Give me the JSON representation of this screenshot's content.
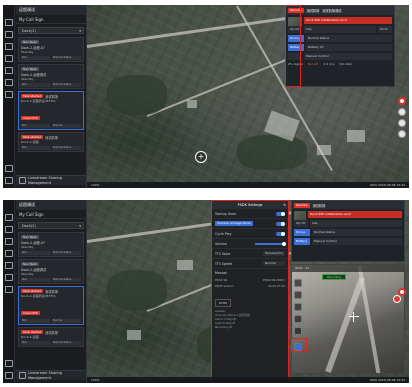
{
  "screens": [
    {
      "sidebar": {
        "header": "远程调试",
        "title": "My Call Sign",
        "selector": "Dock(2)",
        "cards": [
          {
            "pill": "Nav Nest",
            "pill_color": "grey",
            "name": "Dock-2-远程-07",
            "row": "Standby",
            "sub": [
              "N/A",
              "Normal status"
            ]
          },
          {
            "pill": "Nav Nest",
            "pill_color": "grey",
            "name": "Dock-2-远程调试",
            "row": "Standby",
            "sub": [
              "N/A",
              "Normal status"
            ]
          },
          {
            "pill": "Task started",
            "pill_color": "red",
            "name": "测试机场",
            "row": "Dock-2-远程调试(M3TD)",
            "alert": "Check RTK",
            "sub": [
              "N/A",
              "Normal"
            ]
          },
          {
            "pill": "Task started",
            "pill_color": "red",
            "name": "测试机场",
            "row": "Dock-2-远程",
            "sub": [
              "N/A",
              "Normal status"
            ]
          }
        ],
        "uplink": "Livestream Sharing Management"
      },
      "device_panel": {
        "header_tag": "Remote",
        "title": "测试机场",
        "title2": "测试机场调试",
        "alert": "Dock RTK initialization error",
        "rows": [
          [
            "Op Ctl",
            "Idle",
            "Dock"
          ],
          [
            "Drone",
            "Normal status",
            ""
          ],
          [
            "Battery",
            "Battery 97",
            ""
          ],
          [
            "",
            "Manual Control",
            ""
          ]
        ],
        "stats": [
          "0% Signal",
          "N/A Alt",
          "2.9 m/s",
          "N/A Dist"
        ]
      },
      "status": {
        "left": "100%",
        "right": "WGS 2025-08-08 15:44"
      }
    },
    {
      "sidebar": {
        "header": "远程调试",
        "title": "My Call Sign",
        "selector": "Dock(2)",
        "cards": [
          {
            "pill": "Nav Nest",
            "pill_color": "grey",
            "name": "Dock-2-远程-07",
            "row": "Standby",
            "sub": [
              "N/A",
              "Normal status"
            ]
          },
          {
            "pill": "Nav Nest",
            "pill_color": "grey",
            "name": "Dock-2-远程调试",
            "row": "Standby",
            "sub": [
              "N/A",
              "Normal status"
            ]
          },
          {
            "pill": "Task started",
            "pill_color": "red",
            "name": "测试机场",
            "row": "Dock-2-远程调试(M3TD)",
            "alert": "Check RTK",
            "sub": [
              "N/A",
              "Normal"
            ]
          },
          {
            "pill": "Task started",
            "pill_color": "red",
            "name": "测试机场",
            "row": "Dock-2-远程",
            "sub": [
              "N/A",
              "Normal status"
            ]
          }
        ],
        "uplink": "Livestream Sharing Management"
      },
      "psdk": {
        "title": "PSDK Settings",
        "rows": [
          {
            "label": "Startup Voice",
            "type": "toggle",
            "on": true
          },
          {
            "label": "Camera Linkage Mode",
            "type": "button",
            "value": "Enable"
          },
          {
            "label": "Cycle Play",
            "type": "toggle",
            "on": true
          },
          {
            "label": "Volume",
            "type": "slider"
          },
          {
            "label": "TTS Voice",
            "type": "select",
            "value": "Female(Chi)"
          },
          {
            "label": "TTS Speed",
            "type": "select",
            "value": "Normal"
          }
        ],
        "section": "Manual",
        "kv": [
          [
            "PSDK SN",
            "PSDK-SN-00001"
          ],
          [
            "PSDK Version",
            "02.00.07.00"
          ]
        ],
        "stop_label": "STOP",
        "log": [
          "speaker:",
          "channel:1(Dock-2-远程调试)",
          "Alarm Config:off",
          "Light Config:off",
          "Recording:off"
        ]
      },
      "camera": {
        "top_label": "Wide",
        "zoom": "1x",
        "status": "Recording"
      },
      "status": {
        "left": "100%",
        "right": "WGS 2025-08-08 15:44"
      }
    }
  ],
  "colors": {
    "accent": "#3a6fd8",
    "alert": "#d9342b",
    "highlight": "#e0241b",
    "sidebar": "#1b1d21"
  }
}
